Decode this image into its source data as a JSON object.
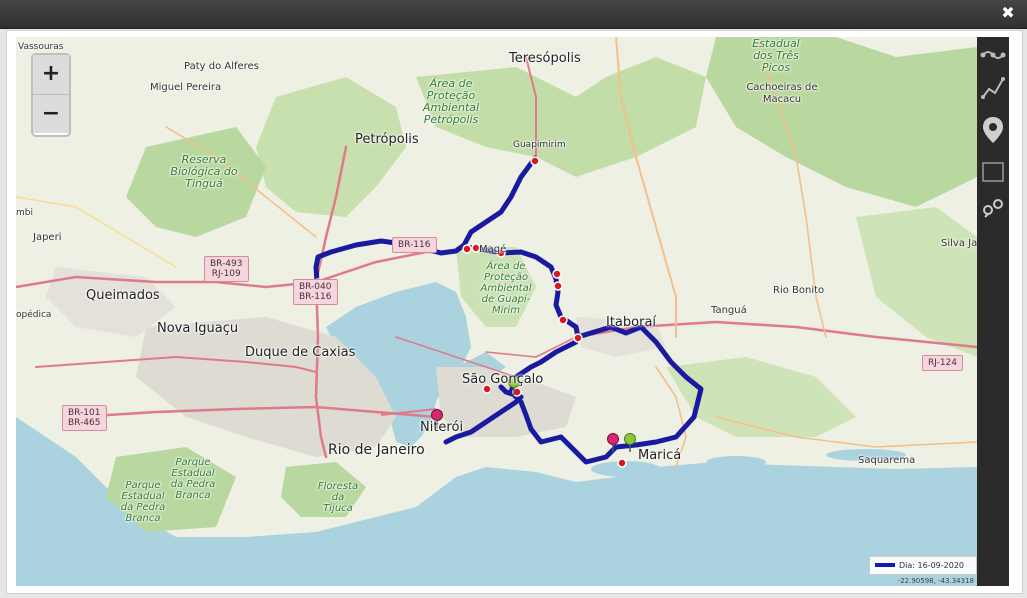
{
  "window": {
    "close_label": "✖"
  },
  "zoom": {
    "in_label": "+",
    "out_label": "−"
  },
  "map_labels": {
    "vassouras": "Vassouras",
    "paty": "Paty do Alferes",
    "miguel": "Miguel Pereira",
    "teresopolis": "Teresópolis",
    "petropolis": "Petrópolis",
    "guapimirim": "Guapimirim",
    "mage": "Magé",
    "japeri": "Japeri",
    "queimados": "Queimados",
    "nova_iguacu": "Nova Iguaçu",
    "duque": "Duque de Caxias",
    "itaborai": "Itaboraí",
    "tangua": "Tanguá",
    "rio_bonito": "Rio Bonito",
    "silva_jardim": "Silva Jar",
    "cachoeiras": "Cachoeiras de Macacu",
    "sao_goncalo": "São Gonçalo",
    "niteroi": "Niterói",
    "rio": "Rio de Janeiro",
    "marica": "Maricá",
    "saquarema": "Saquarema",
    "seropedica": "opédica",
    "left_edge": "mbi"
  },
  "park_labels": {
    "protecao_petropolis": "Área de Proteção Ambiental Petrópolis",
    "reserva_tingua": "Reserva Biológica do Tinguá",
    "tres_picos": "Estadual dos Três Picos",
    "protecao_guapi": "Área de Proteção Ambiental de Guapi-Mirim",
    "pedra_branca_1": "Parque Estadual da Pedra Branca",
    "pedra_branca_2": "Parque Estadual da Pedra Branca",
    "tijuca": "Floresta da Tijuca"
  },
  "shields": {
    "br493": "BR-493",
    "rj109": "RJ-109",
    "br040": "BR-040",
    "br116a": "BR-116",
    "br116b": "BR-116",
    "br101": "BR-101",
    "br465": "BR-465",
    "rj124": "RJ-124"
  },
  "tools": [
    {
      "name": "route-tool-icon"
    },
    {
      "name": "path-tool-icon"
    },
    {
      "name": "marker-tool-icon"
    },
    {
      "name": "rectangle-tool-icon"
    },
    {
      "name": "points-tool-icon"
    }
  ],
  "legend": {
    "label": "Dia: 16-09-2020",
    "route_color": "#1a1aa0"
  },
  "coordinates": "-22.90598, -43.34318"
}
